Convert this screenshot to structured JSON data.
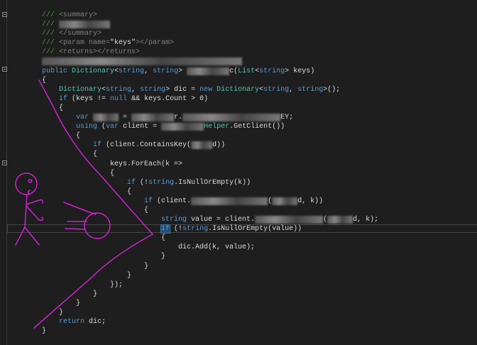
{
  "editor": {
    "fold_markers": [
      "summary",
      "method",
      "lambda"
    ],
    "colors": {
      "background": "#1e1e1e",
      "keyword": "#569cd6",
      "type": "#4ec9b0",
      "comment": "#57a64a",
      "text": "#dcdcdc",
      "drawing": "#d020d0"
    },
    "lines": [
      [
        [
          "c",
          "/// "
        ],
        [
          "x",
          "<summary>"
        ]
      ],
      [
        [
          "c",
          "/// "
        ],
        [
          "b",
          "XXXXXXXXXXXX"
        ]
      ],
      [
        [
          "c",
          "/// "
        ],
        [
          "x",
          "</summary>"
        ]
      ],
      [
        [
          "c",
          "/// "
        ],
        [
          "x",
          "<param name="
        ],
        [
          "s",
          "\"keys\""
        ],
        [
          "x",
          "></param>"
        ]
      ],
      [
        [
          "c",
          "/// "
        ],
        [
          "x",
          "<returns></returns>"
        ]
      ],
      [
        [
          "b",
          "XXXXXXXXXXXXXXXXXXXXXXXXXXXXXXXXXXXXXXXXXXXXXXX"
        ]
      ],
      [
        [
          "k",
          "public "
        ],
        [
          "t",
          "Dictionary"
        ],
        [
          "p",
          "<"
        ],
        [
          "k",
          "string"
        ],
        [
          "p",
          ", "
        ],
        [
          "k",
          "string"
        ],
        [
          "p",
          "> "
        ],
        [
          "b",
          "XXXXXXXXXX"
        ],
        [
          "p",
          "c("
        ],
        [
          "t",
          "List"
        ],
        [
          "p",
          "<"
        ],
        [
          "k",
          "string"
        ],
        [
          "p",
          "> keys)"
        ]
      ],
      [
        [
          "p",
          "{"
        ]
      ],
      [
        [
          "p",
          "    "
        ],
        [
          "t",
          "Dictionary"
        ],
        [
          "p",
          "<"
        ],
        [
          "k",
          "string"
        ],
        [
          "p",
          ", "
        ],
        [
          "k",
          "string"
        ],
        [
          "p",
          "> dic = "
        ],
        [
          "k",
          "new "
        ],
        [
          "t",
          "Dictionary"
        ],
        [
          "p",
          "<"
        ],
        [
          "k",
          "string"
        ],
        [
          "p",
          ", "
        ],
        [
          "k",
          "string"
        ],
        [
          "p",
          ">();"
        ]
      ],
      [
        [
          "p",
          "    "
        ],
        [
          "k",
          "if"
        ],
        [
          "p",
          " (keys != "
        ],
        [
          "k",
          "null"
        ],
        [
          "p",
          " && keys.Count > 0)"
        ]
      ],
      [
        [
          "p",
          "    {"
        ]
      ],
      [
        [
          "p",
          "        "
        ],
        [
          "k",
          "var "
        ],
        [
          "b",
          "XXXXXX"
        ],
        [
          "p",
          " = "
        ],
        [
          "b",
          "XXXXXXXXXX"
        ],
        [
          "p",
          "r."
        ],
        [
          "b",
          "XXXXXXXXXXXXXXXXXXXXXXX"
        ],
        [
          "p",
          "EY;"
        ]
      ],
      [
        [
          "p",
          "        "
        ],
        [
          "k",
          "using"
        ],
        [
          "p",
          " ("
        ],
        [
          "k",
          "var"
        ],
        [
          "p",
          " client = "
        ],
        [
          "b",
          "XXXXXXXXXX"
        ],
        [
          "t",
          "Helper"
        ],
        [
          "p",
          ".GetClient())"
        ]
      ],
      [
        [
          "p",
          "        {"
        ]
      ],
      [
        [
          "p",
          "            "
        ],
        [
          "k",
          "if"
        ],
        [
          "p",
          " (client.ContainsKey("
        ],
        [
          "b",
          "XXXXX"
        ],
        [
          "p",
          "d))"
        ]
      ],
      [
        [
          "p",
          "            {"
        ]
      ],
      [
        [
          "p",
          "                keys.ForEach(k =>"
        ]
      ],
      [
        [
          "p",
          "                {"
        ]
      ],
      [
        [
          "p",
          "                    "
        ],
        [
          "k",
          "if"
        ],
        [
          "p",
          " (!"
        ],
        [
          "k",
          "string"
        ],
        [
          "p",
          ".IsNullOrEmpty(k))"
        ]
      ],
      [
        [
          "p",
          "                    {"
        ]
      ],
      [
        [
          "p",
          "                        "
        ],
        [
          "k",
          "if"
        ],
        [
          "p",
          " (client."
        ],
        [
          "b",
          "XXXXXXXXXXXXXXXXXX"
        ],
        [
          "p",
          "("
        ],
        [
          "b",
          "XXXXXX"
        ],
        [
          "p",
          "d, k))"
        ]
      ],
      [
        [
          "p",
          "                        {"
        ]
      ],
      [
        [
          "p",
          "                            "
        ],
        [
          "k",
          "string"
        ],
        [
          "p",
          " value = client."
        ],
        [
          "b",
          "XXXXXXXXXXXXXXXX"
        ],
        [
          "p",
          "("
        ],
        [
          "b",
          "XXXXXX"
        ],
        [
          "p",
          "d, k);"
        ]
      ],
      [
        [
          "p",
          "                            "
        ],
        [
          "h",
          "if"
        ],
        [
          "p",
          " (!"
        ],
        [
          "k",
          "string"
        ],
        [
          "p",
          ".IsNullOrEmpty(value))"
        ]
      ],
      [
        [
          "p",
          "                            {"
        ]
      ],
      [
        [
          "p",
          "                                dic.Add(k, value);"
        ]
      ],
      [
        [
          "p",
          "                            }"
        ]
      ],
      [
        [
          "p",
          "                        }"
        ]
      ],
      [
        [
          "p",
          "                    }"
        ]
      ],
      [
        [
          "p",
          "                });"
        ]
      ],
      [
        [
          "p",
          "            }"
        ]
      ],
      [
        [
          "p",
          "        }"
        ]
      ],
      [
        [
          "p",
          "    }"
        ]
      ],
      [
        [
          "p",
          "    "
        ],
        [
          "k",
          "return"
        ],
        [
          "p",
          " dic;"
        ]
      ],
      [
        [
          "p",
          "}"
        ]
      ]
    ]
  }
}
